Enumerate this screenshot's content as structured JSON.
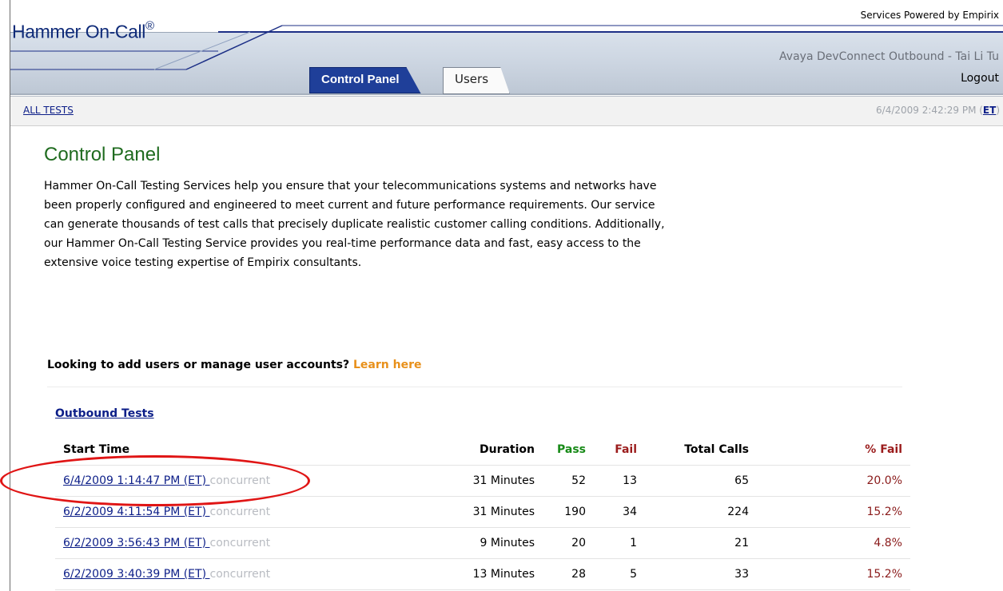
{
  "header": {
    "brand": "Hammer On-Call",
    "brand_mark": "®",
    "powered_by": "Services Powered by Empirix",
    "account": "Avaya DevConnect Outbound - Tai Li Tu",
    "logout": "Logout",
    "tabs": [
      {
        "label": "Control Panel",
        "active": true
      },
      {
        "label": "Users",
        "active": false
      }
    ]
  },
  "breadcrumb": {
    "label": "ALL TESTS",
    "datetime": "6/4/2009 2:42:29 PM (",
    "timezone": "ET",
    "datetime_close": ")"
  },
  "main": {
    "title": "Control Panel",
    "intro": "Hammer On-Call Testing Services help you ensure that your telecommunications systems and networks have been properly configured and engineered to meet current and future performance requirements. Our service can generate thousands of test calls that precisely duplicate realistic customer calling conditions. Additionally, our Hammer On-Call Testing Service provides you real-time performance data and fast, easy access to the extensive voice testing expertise of Empirix consultants.",
    "users_prompt": "Looking to add users or manage user accounts? ",
    "learn_here": "Learn here",
    "section_title": "Outbound Tests",
    "columns": {
      "start_time": "Start Time",
      "duration": "Duration",
      "pass": "Pass",
      "fail": "Fail",
      "total_calls": "Total Calls",
      "pct_fail": "% Fail"
    },
    "rows": [
      {
        "start": "6/4/2009 1:14:47 PM (ET) ",
        "type": "concurrent",
        "duration": "31 Minutes",
        "pass": "52",
        "fail": "13",
        "total": "65",
        "pct": "20.0%"
      },
      {
        "start": "6/2/2009 4:11:54 PM (ET) ",
        "type": "concurrent",
        "duration": "31 Minutes",
        "pass": "190",
        "fail": "34",
        "total": "224",
        "pct": "15.2%"
      },
      {
        "start": "6/2/2009 3:56:43 PM (ET) ",
        "type": "concurrent",
        "duration": "9 Minutes",
        "pass": "20",
        "fail": "1",
        "total": "21",
        "pct": "4.8%"
      },
      {
        "start": "6/2/2009 3:40:39 PM (ET) ",
        "type": "concurrent",
        "duration": "13 Minutes",
        "pass": "28",
        "fail": "5",
        "total": "33",
        "pct": "15.2%"
      }
    ]
  },
  "colors": {
    "brand_blue": "#0e2a78",
    "tab_active": "#1f3f99",
    "title_green": "#1f6b1f",
    "link_orange": "#e8901a",
    "highlight_red": "#e01515"
  }
}
